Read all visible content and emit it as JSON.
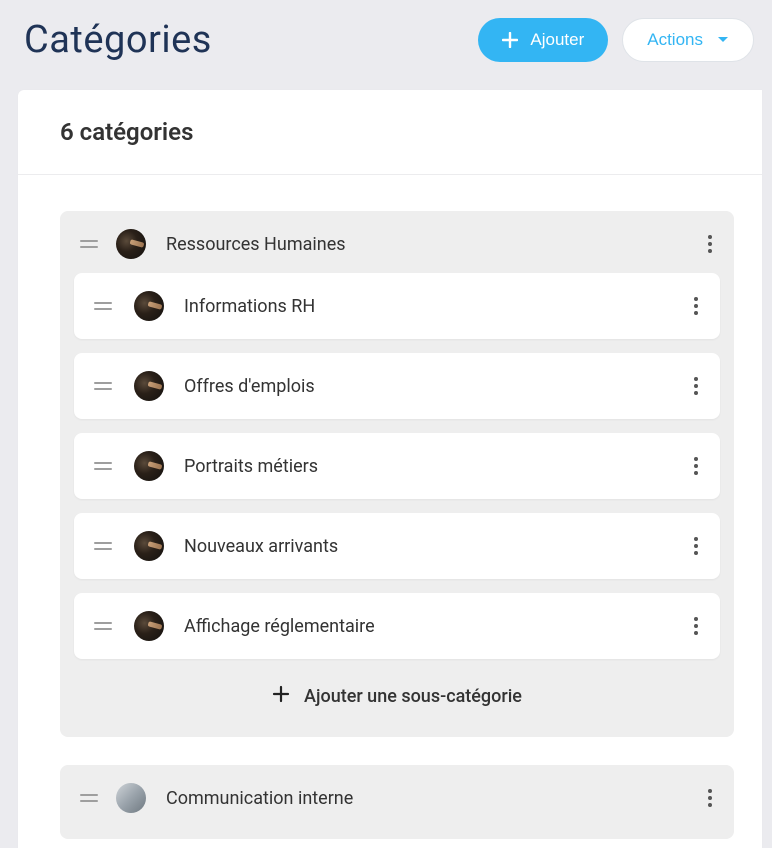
{
  "header": {
    "title": "Catégories",
    "add_label": "Ajouter",
    "actions_label": "Actions"
  },
  "panel": {
    "count_label": "6 catégories",
    "add_sub_label": "Ajouter une sous-catégorie"
  },
  "groups": [
    {
      "name": "Ressources Humaines",
      "children": [
        "Informations RH",
        "Offres d'emplois",
        "Portraits métiers",
        "Nouveaux arrivants",
        "Affichage réglementaire"
      ]
    },
    {
      "name": "Communication interne",
      "children": []
    }
  ]
}
